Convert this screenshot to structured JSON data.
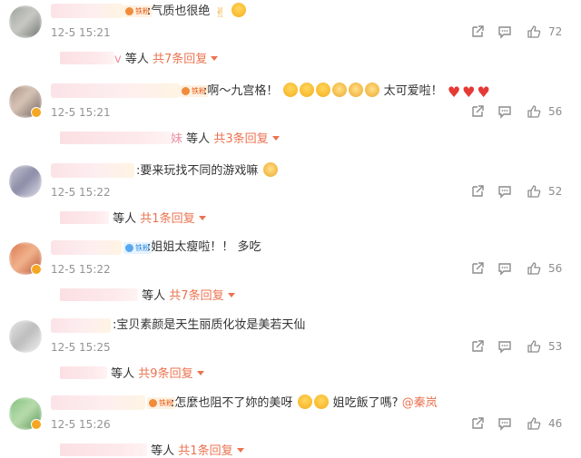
{
  "comments": [
    {
      "fan_badge": "铁粉",
      "text": ":气质也很绝",
      "time": "12-5 15:21",
      "likes": "72",
      "reply_tail": "v",
      "reply_who": "等人",
      "reply_count": "共7条回复"
    },
    {
      "fan_badge": "铁粉",
      "text": ":啊～九宫格！",
      "text2": "太可爱啦！",
      "time": "12-5 15:21",
      "likes": "56",
      "reply_tail": "妹",
      "reply_who": "等人",
      "reply_count": "共3条回复"
    },
    {
      "text": ":要来玩找不同的游戏嘛",
      "time": "12-5 15:22",
      "likes": "52",
      "reply_who": "等人",
      "reply_count": "共1条回复"
    },
    {
      "fan_badge": "铁粉",
      "text": ":姐姐太瘦啦！！ 多吃",
      "time": "12-5 15:22",
      "likes": "56",
      "reply_who": "等人",
      "reply_count": "共7条回复"
    },
    {
      "text": ":宝贝素颜是天生丽质化妆是美若天仙",
      "time": "12-5 15:25",
      "likes": "53",
      "reply_who": "等人",
      "reply_count": "共9条回复"
    },
    {
      "fan_badge": "铁粉",
      "text": ":怎麼也阻不了妳的美呀",
      "text2": "姐吃飯了嗎?",
      "mention": "@秦岚",
      "time": "12-5 15:26",
      "likes": "46",
      "reply_who": "等人",
      "reply_count": "共1条回复"
    }
  ],
  "icons": {
    "share": "share-icon",
    "comment": "comment-icon",
    "like": "thumbs-up-icon",
    "more": "caret-down-icon"
  },
  "colors": {
    "accent": "#eb7350",
    "meta": "#939393",
    "heart": "#e53935"
  }
}
